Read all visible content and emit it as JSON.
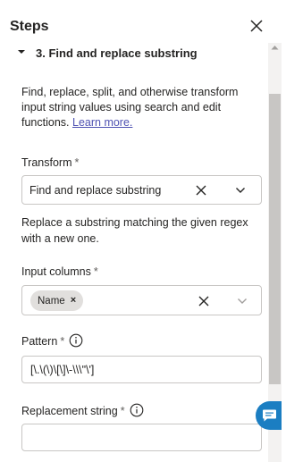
{
  "panel": {
    "title": "Steps"
  },
  "step": {
    "title": "3. Find and replace substring"
  },
  "description": {
    "text": "Find, replace, split, and otherwise transform input string values using search and edit functions.",
    "link": "Learn more."
  },
  "transform": {
    "label": "Transform",
    "required_mark": "*",
    "value": "Find and replace substring",
    "help": "Replace a substring matching the given regex with a new one."
  },
  "input_columns": {
    "label": "Input columns",
    "required_mark": "*",
    "tags": [
      "Name"
    ],
    "tag_remove": "×"
  },
  "pattern": {
    "label": "Pattern",
    "required_mark": "*",
    "value": "[\\.\\(\\)\\[\\]\\-\\\\\\\"\\']"
  },
  "replacement": {
    "label": "Replacement string",
    "required_mark": "*",
    "value": ""
  },
  "colors": {
    "accent": "#1b7ec2",
    "link": "#4f52b2",
    "border": "#c8c6c4",
    "tag_bg": "#e1dfdd"
  },
  "icons": [
    "close-icon",
    "chevron-down-icon",
    "clear-icon",
    "info-icon",
    "chat-icon"
  ]
}
